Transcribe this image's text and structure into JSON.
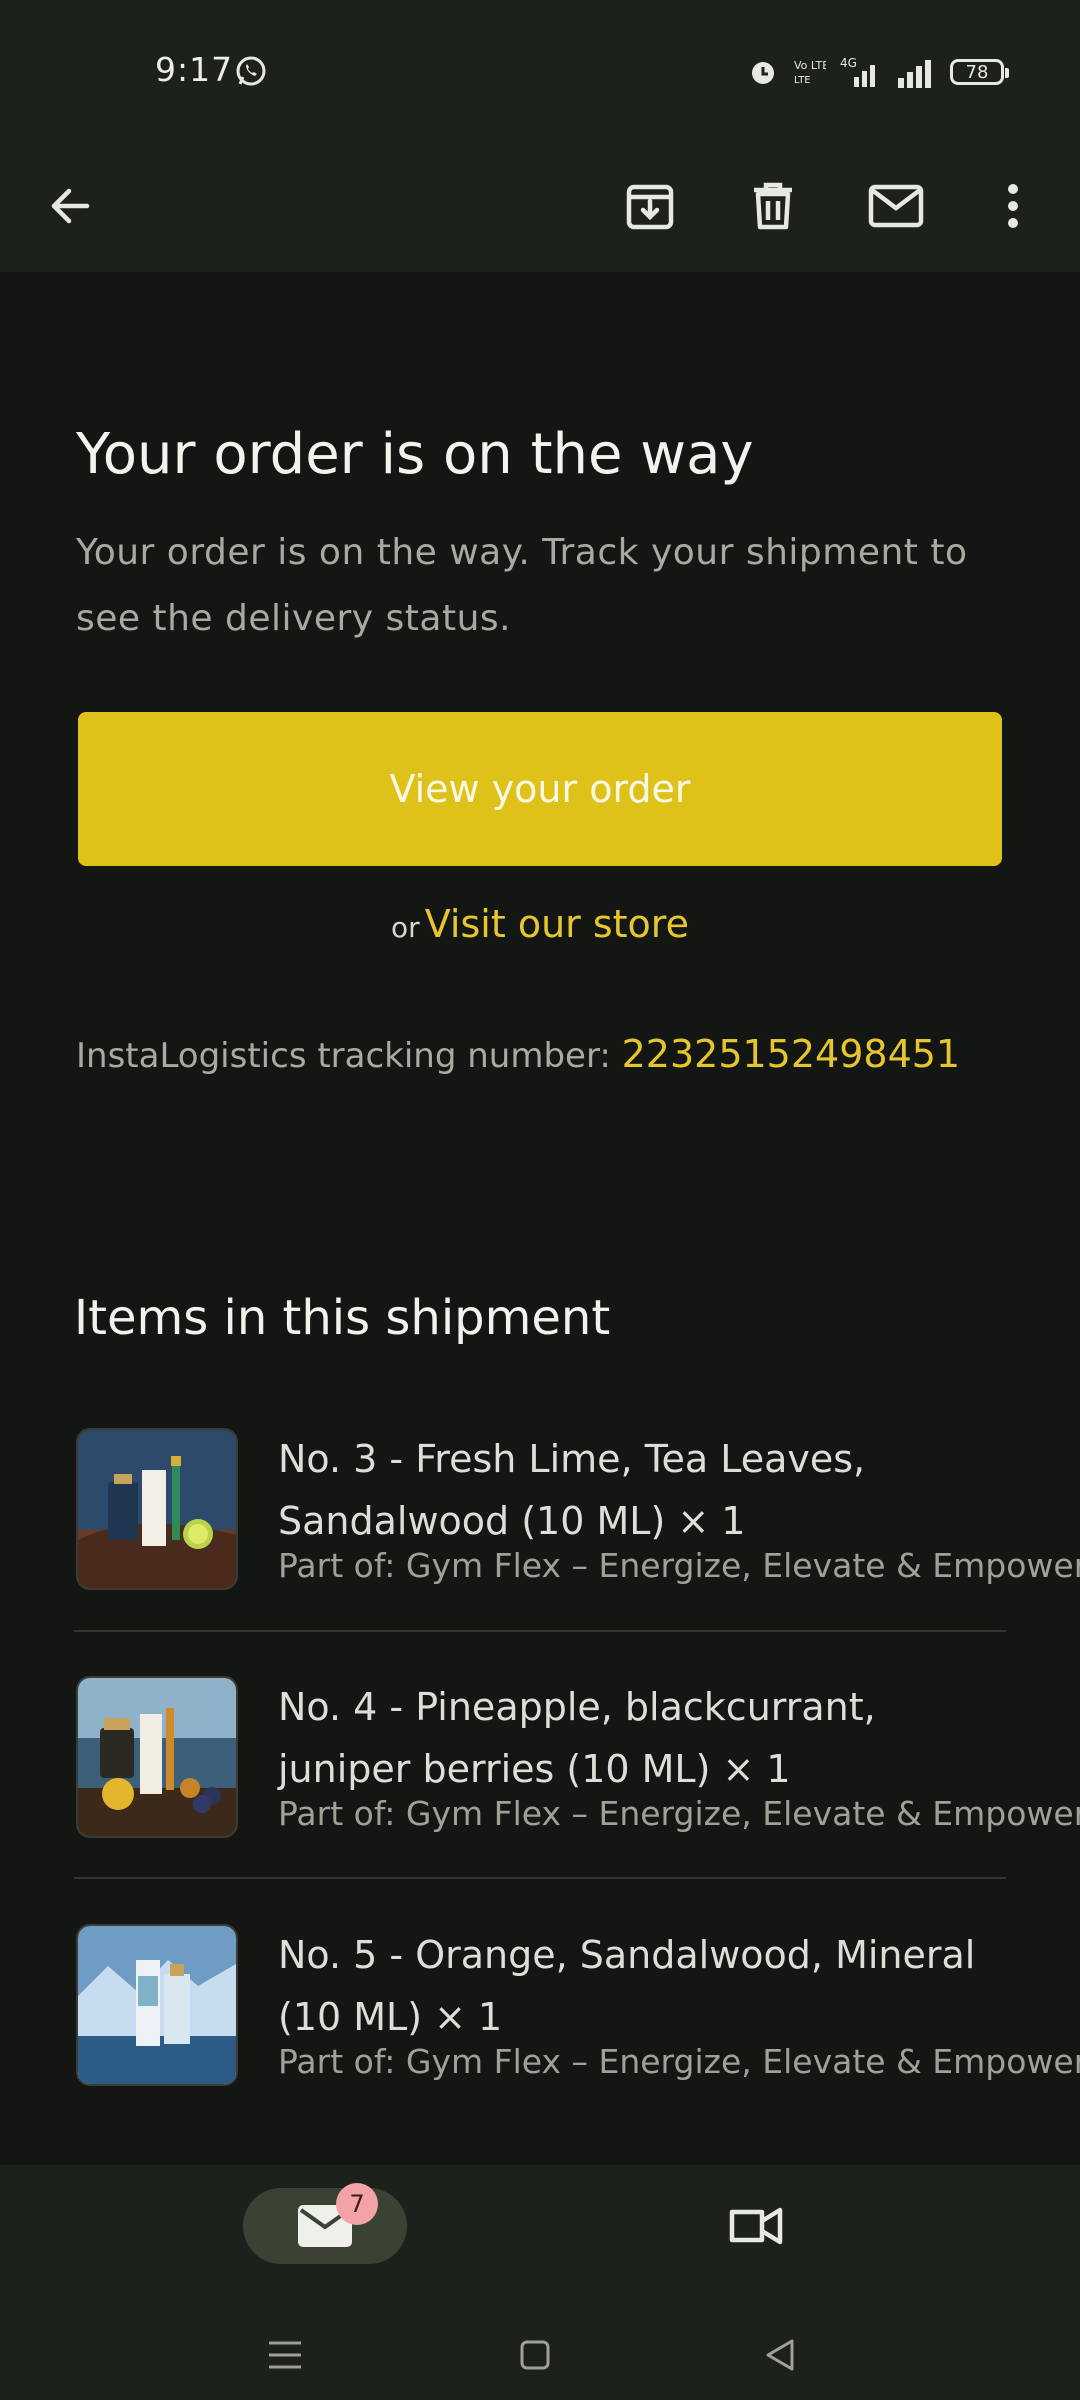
{
  "status_bar": {
    "time": "9:17",
    "network_label": "4G",
    "volte_label": "Vo LTE",
    "battery": "78"
  },
  "toolbar": {
    "icons": [
      "back-arrow-icon",
      "archive-icon",
      "delete-icon",
      "mark-unread-icon",
      "more-vert-icon"
    ]
  },
  "email": {
    "title": "Your order is on the way",
    "subtitle": "Your order is on the way. Track your shipment to see the delivery status.",
    "cta_label": "View your order",
    "alt_prefix": "or",
    "alt_link": "Visit our store",
    "tracking_label": "InstaLogistics tracking number:",
    "tracking_number": "22325152498451",
    "items_title": "Items in this shipment",
    "items": [
      {
        "name": "No. 3 - Fresh Lime, Tea Leaves, Sandalwood (10 ML) × 1",
        "part_of": "Part of: Gym Flex – Energize, Elevate & Empower"
      },
      {
        "name": "No. 4 - Pineapple, blackcurrant, juniper berries (10 ML) × 1",
        "part_of": "Part of: Gym Flex – Energize, Elevate & Empower"
      },
      {
        "name": "No. 5 - Orange, Sandalwood, Mineral (10 ML) × 1",
        "part_of": "Part of: Gym Flex – Energize, Elevate & Empower"
      }
    ]
  },
  "bottom_nav": {
    "mail_badge": "7"
  },
  "colors": {
    "accent_yellow": "#dfc219",
    "link_yellow": "#e7c72d",
    "background": "#131612",
    "bar": "#1d211b"
  }
}
